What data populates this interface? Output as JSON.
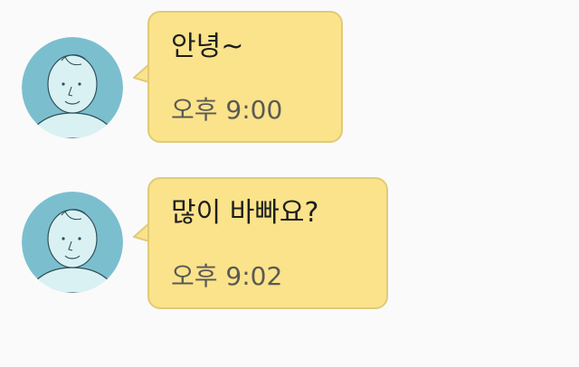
{
  "conversation": {
    "messages": [
      {
        "text": "안녕~",
        "time": "오후 9:00"
      },
      {
        "text": "많이 바빠요?",
        "time": "오후 9:02"
      }
    ]
  },
  "avatar_icon": "default-person-avatar-icon",
  "colors": {
    "background": "#fafafa",
    "bubble_fill": "#fbe38b",
    "bubble_border": "#e0ca78",
    "avatar_bg": "#7bbfcf",
    "avatar_face": "#daf1f4",
    "text": "#1e1e1e",
    "time_text": "#5a5a55"
  }
}
